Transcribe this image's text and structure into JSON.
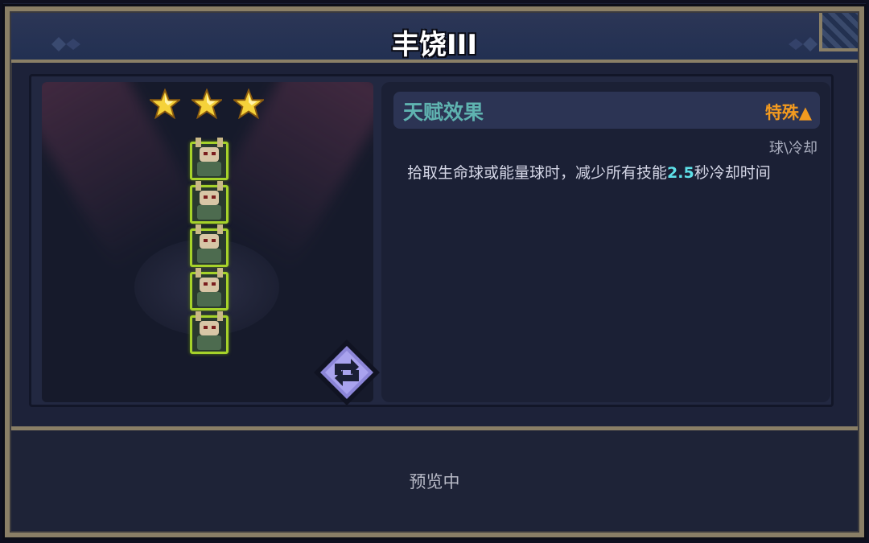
{
  "header": {
    "title": "丰饶III"
  },
  "stars": {
    "count": 3,
    "color": "#f5d23a"
  },
  "units": {
    "count": 5,
    "frame_color": "#a6d22a"
  },
  "talent": {
    "title": "天赋效果",
    "tag": "特殊▲",
    "tag_color": "#f29a1f",
    "category": "球\\冷却",
    "description_prefix": "拾取生命球或能量球时，减少所有技能",
    "description_value": "2.5",
    "description_suffix": "秒冷却时间",
    "value_color": "#5ee0e8"
  },
  "footer": {
    "status": "预览中"
  },
  "icons": {
    "star": "star-icon",
    "refresh": "refresh-icon",
    "decor": "ornament-icon"
  }
}
